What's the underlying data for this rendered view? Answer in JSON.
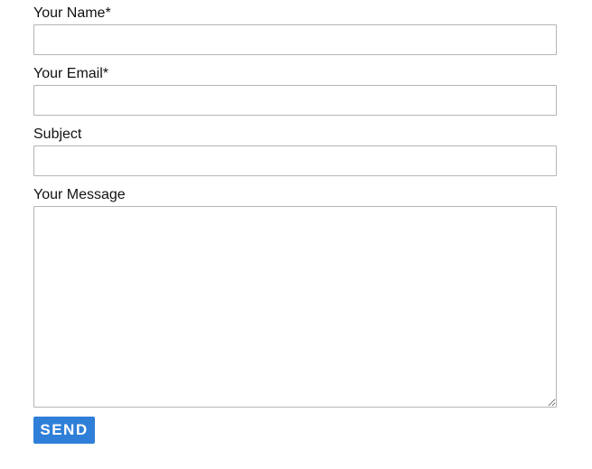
{
  "form": {
    "name": {
      "label": "Your Name*",
      "value": "",
      "placeholder": ""
    },
    "email": {
      "label": "Your Email*",
      "value": "",
      "placeholder": ""
    },
    "subject": {
      "label": "Subject",
      "value": "",
      "placeholder": ""
    },
    "message": {
      "label": "Your Message",
      "value": "",
      "placeholder": ""
    },
    "submit_label": "SEND"
  },
  "colors": {
    "button_bg": "#2f7fd8",
    "button_text": "#ffffff",
    "input_border": "#b5b5b5",
    "label_text": "#111111"
  }
}
